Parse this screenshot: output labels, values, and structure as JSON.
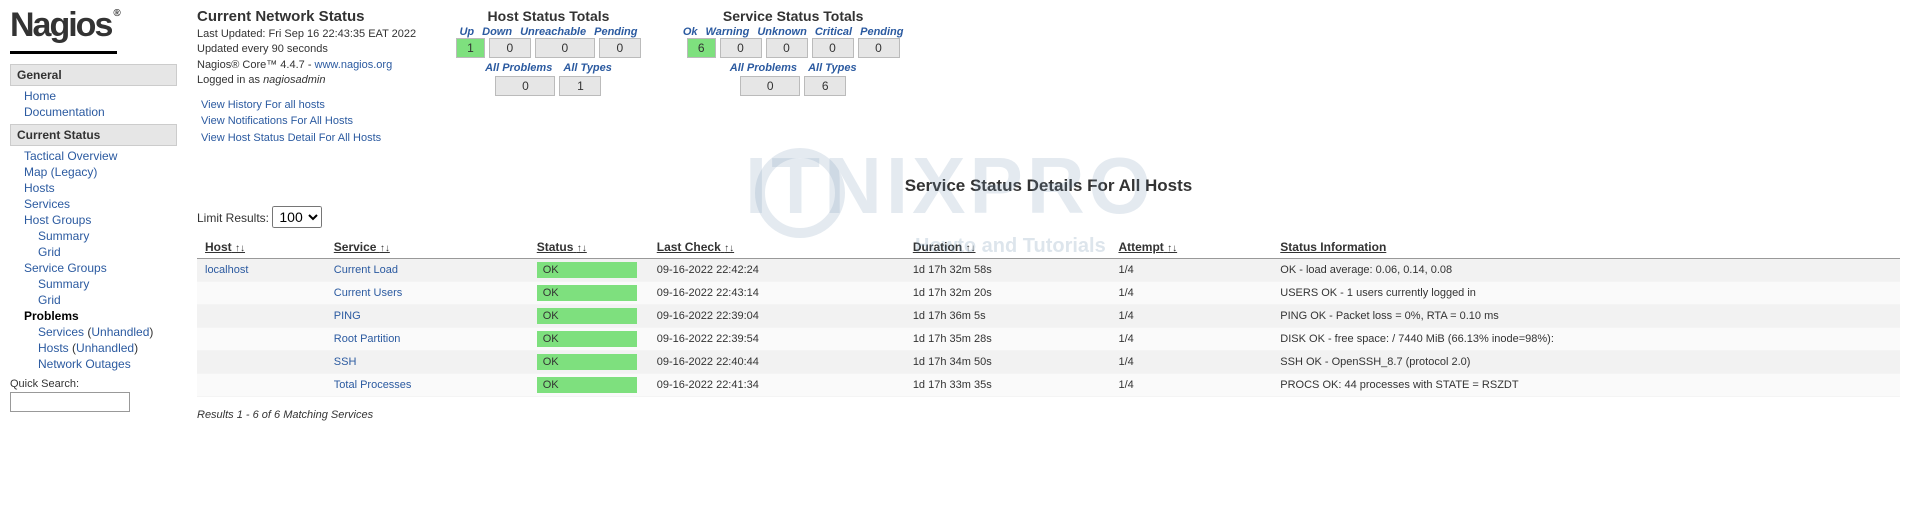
{
  "logo": {
    "text": "Nagios",
    "reg": "®"
  },
  "sidebar": {
    "sections": [
      {
        "title": "General",
        "items": [
          "Home",
          "Documentation"
        ]
      },
      {
        "title": "Current Status",
        "items": [
          "Tactical Overview",
          "Map     (Legacy)",
          "Hosts",
          "Services",
          "Host Groups",
          "Summary",
          "Grid",
          "Service Groups",
          "Summary",
          "Grid",
          "Problems",
          "Services",
          "Unhandled",
          "Hosts",
          "Unhandled",
          "Network Outages"
        ]
      }
    ],
    "quick_search_label": "Quick Search:"
  },
  "status_block": {
    "title": "Current Network Status",
    "last_updated": "Last Updated: Fri Sep 16 22:43:35 EAT 2022",
    "update_interval": "Updated every 90 seconds",
    "product": "Nagios® Core™ 4.4.7 - ",
    "product_link": "www.nagios.org",
    "logged_in": "Logged in as ",
    "user": "nagiosadmin",
    "links": [
      "View History For all hosts",
      "View Notifications For All Hosts",
      "View Host Status Detail For All Hosts"
    ]
  },
  "host_totals": {
    "title": "Host Status Totals",
    "heads": [
      "Up",
      "Down",
      "Unreachable",
      "Pending"
    ],
    "values": [
      "1",
      "0",
      "0",
      "0"
    ],
    "sub_heads": [
      "All Problems",
      "All Types"
    ],
    "sub_values": [
      "0",
      "1"
    ]
  },
  "service_totals": {
    "title": "Service Status Totals",
    "heads": [
      "Ok",
      "Warning",
      "Unknown",
      "Critical",
      "Pending"
    ],
    "values": [
      "6",
      "0",
      "0",
      "0",
      "0"
    ],
    "sub_heads": [
      "All Problems",
      "All Types"
    ],
    "sub_values": [
      "0",
      "6"
    ]
  },
  "details": {
    "title": "Service Status Details For All Hosts",
    "limit_label": "Limit Results:",
    "limit_value": "100",
    "columns": [
      "Host",
      "Service",
      "Status",
      "Last Check",
      "Duration",
      "Attempt",
      "Status Information"
    ],
    "rows": [
      {
        "host": "localhost",
        "service": "Current Load",
        "status": "OK",
        "last_check": "09-16-2022 22:42:24",
        "duration": "1d 17h 32m 58s",
        "attempt": "1/4",
        "info": "OK - load average: 0.06, 0.14, 0.08"
      },
      {
        "host": "",
        "service": "Current Users",
        "status": "OK",
        "last_check": "09-16-2022 22:43:14",
        "duration": "1d 17h 32m 20s",
        "attempt": "1/4",
        "info": "USERS OK - 1 users currently logged in"
      },
      {
        "host": "",
        "service": "PING",
        "status": "OK",
        "last_check": "09-16-2022 22:39:04",
        "duration": "1d 17h 36m 5s",
        "attempt": "1/4",
        "info": "PING OK - Packet loss = 0%, RTA = 0.10 ms"
      },
      {
        "host": "",
        "service": "Root Partition",
        "status": "OK",
        "last_check": "09-16-2022 22:39:54",
        "duration": "1d 17h 35m 28s",
        "attempt": "1/4",
        "info": "DISK OK - free space: / 7440 MiB (66.13% inode=98%):"
      },
      {
        "host": "",
        "service": "SSH",
        "status": "OK",
        "last_check": "09-16-2022 22:40:44",
        "duration": "1d 17h 34m 50s",
        "attempt": "1/4",
        "info": "SSH OK - OpenSSH_8.7 (protocol 2.0)"
      },
      {
        "host": "",
        "service": "Total Processes",
        "status": "OK",
        "last_check": "09-16-2022 22:41:34",
        "duration": "1d 17h 33m 35s",
        "attempt": "1/4",
        "info": "PROCS OK: 44 processes with STATE = RSZDT"
      }
    ],
    "results_note": "Results 1 - 6 of 6 Matching Services"
  },
  "watermark": {
    "text": "ITNIXPRO",
    "sub": "Howto and Tutorials"
  }
}
